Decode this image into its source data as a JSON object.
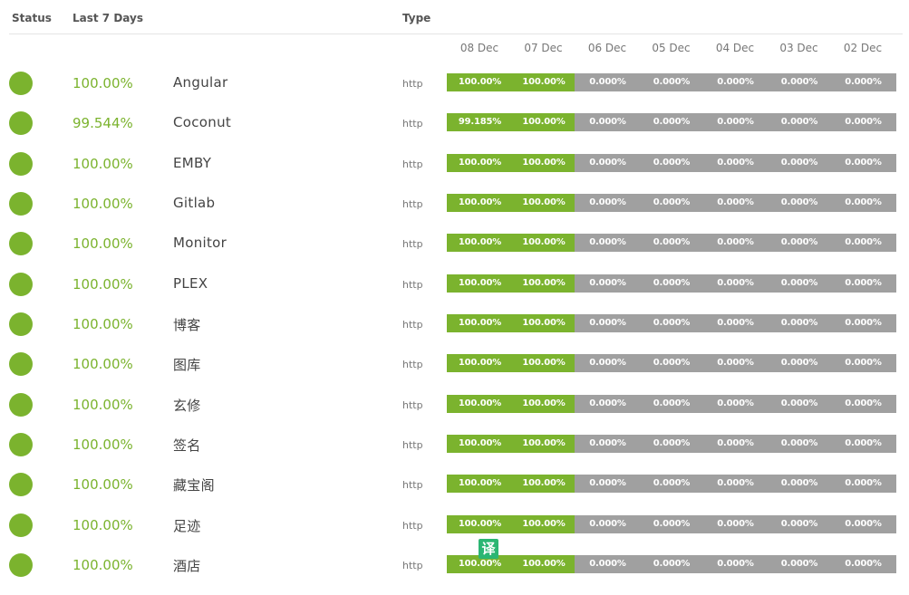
{
  "header": {
    "status_label": "Status",
    "last7_label": "Last 7 Days",
    "type_label": "Type"
  },
  "colors": {
    "up": "#7bb32e",
    "down": "#a0a0a0",
    "translate_badge": "#2bb673"
  },
  "dates": [
    "08 Dec",
    "07 Dec",
    "06 Dec",
    "05 Dec",
    "04 Dec",
    "03 Dec",
    "02 Dec"
  ],
  "monitors": [
    {
      "status": "up",
      "uptime": "100.00%",
      "name": "Angular",
      "type": "http",
      "days": [
        "100.00%",
        "100.00%",
        "0.000%",
        "0.000%",
        "0.000%",
        "0.000%",
        "0.000%"
      ]
    },
    {
      "status": "up",
      "uptime": "99.544%",
      "name": "Coconut",
      "type": "http",
      "days": [
        "99.185%",
        "100.00%",
        "0.000%",
        "0.000%",
        "0.000%",
        "0.000%",
        "0.000%"
      ]
    },
    {
      "status": "up",
      "uptime": "100.00%",
      "name": "EMBY",
      "type": "http",
      "days": [
        "100.00%",
        "100.00%",
        "0.000%",
        "0.000%",
        "0.000%",
        "0.000%",
        "0.000%"
      ]
    },
    {
      "status": "up",
      "uptime": "100.00%",
      "name": "Gitlab",
      "type": "http",
      "days": [
        "100.00%",
        "100.00%",
        "0.000%",
        "0.000%",
        "0.000%",
        "0.000%",
        "0.000%"
      ]
    },
    {
      "status": "up",
      "uptime": "100.00%",
      "name": "Monitor",
      "type": "http",
      "days": [
        "100.00%",
        "100.00%",
        "0.000%",
        "0.000%",
        "0.000%",
        "0.000%",
        "0.000%"
      ]
    },
    {
      "status": "up",
      "uptime": "100.00%",
      "name": "PLEX",
      "type": "http",
      "days": [
        "100.00%",
        "100.00%",
        "0.000%",
        "0.000%",
        "0.000%",
        "0.000%",
        "0.000%"
      ]
    },
    {
      "status": "up",
      "uptime": "100.00%",
      "name": "博客",
      "type": "http",
      "days": [
        "100.00%",
        "100.00%",
        "0.000%",
        "0.000%",
        "0.000%",
        "0.000%",
        "0.000%"
      ]
    },
    {
      "status": "up",
      "uptime": "100.00%",
      "name": "图库",
      "type": "http",
      "days": [
        "100.00%",
        "100.00%",
        "0.000%",
        "0.000%",
        "0.000%",
        "0.000%",
        "0.000%"
      ]
    },
    {
      "status": "up",
      "uptime": "100.00%",
      "name": "玄修",
      "type": "http",
      "days": [
        "100.00%",
        "100.00%",
        "0.000%",
        "0.000%",
        "0.000%",
        "0.000%",
        "0.000%"
      ]
    },
    {
      "status": "up",
      "uptime": "100.00%",
      "name": "签名",
      "type": "http",
      "days": [
        "100.00%",
        "100.00%",
        "0.000%",
        "0.000%",
        "0.000%",
        "0.000%",
        "0.000%"
      ]
    },
    {
      "status": "up",
      "uptime": "100.00%",
      "name": "藏宝阁",
      "type": "http",
      "days": [
        "100.00%",
        "100.00%",
        "0.000%",
        "0.000%",
        "0.000%",
        "0.000%",
        "0.000%"
      ]
    },
    {
      "status": "up",
      "uptime": "100.00%",
      "name": "足迹",
      "type": "http",
      "days": [
        "100.00%",
        "100.00%",
        "0.000%",
        "0.000%",
        "0.000%",
        "0.000%",
        "0.000%"
      ]
    },
    {
      "status": "up",
      "uptime": "100.00%",
      "name": "酒店",
      "type": "http",
      "days": [
        "100.00%",
        "100.00%",
        "0.000%",
        "0.000%",
        "0.000%",
        "0.000%",
        "0.000%"
      ]
    }
  ],
  "translate_badge": {
    "label": "译",
    "icon": "translate-icon"
  }
}
